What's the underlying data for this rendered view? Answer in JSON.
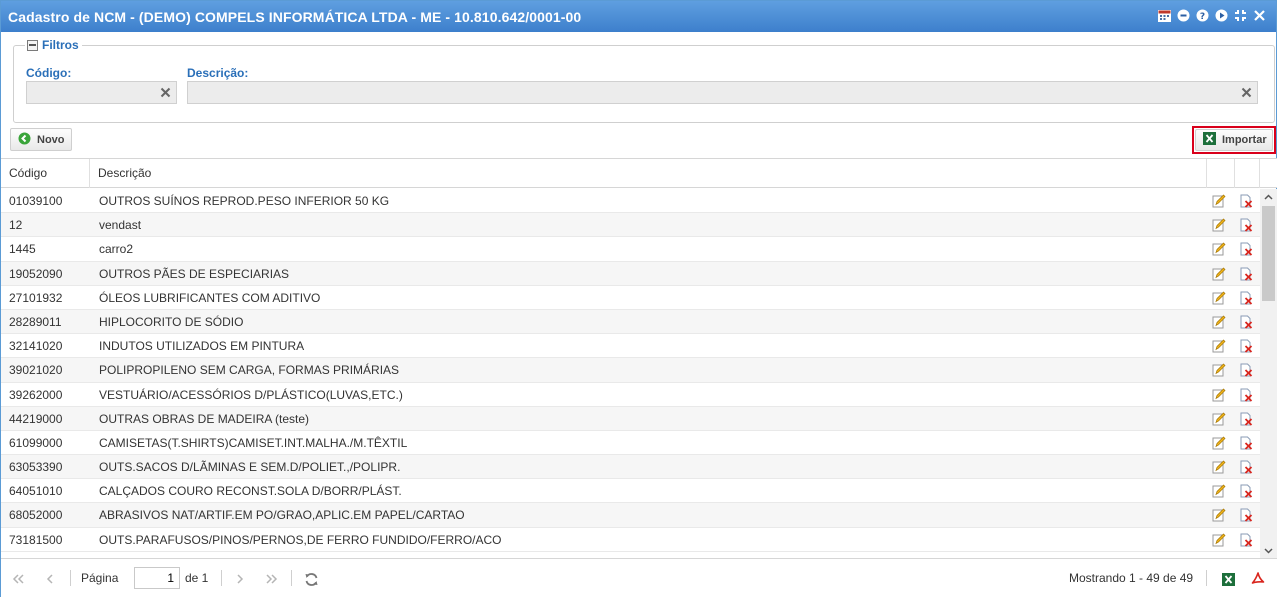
{
  "window": {
    "title": "Cadastro de NCM - (DEMO) COMPELS INFORMÁTICA LTDA - ME - 10.810.642/0001-00",
    "titlebar_icons": [
      "calendar-icon",
      "minimize-icon",
      "help-icon",
      "play-icon",
      "expand-icon",
      "close-icon"
    ]
  },
  "filters": {
    "legend": "Filtros",
    "codigo_label": "Código:",
    "codigo_value": "",
    "descricao_label": "Descrição:",
    "descricao_value": ""
  },
  "toolbar": {
    "novo_label": "Novo",
    "importar_label": "Importar"
  },
  "grid": {
    "columns": [
      "Código",
      "Descrição"
    ],
    "rows": [
      {
        "codigo": "01039100",
        "descricao": "OUTROS SUÍNOS REPROD.PESO INFERIOR 50 KG"
      },
      {
        "codigo": "12",
        "descricao": "vendast"
      },
      {
        "codigo": "1445",
        "descricao": "carro2"
      },
      {
        "codigo": "19052090",
        "descricao": "OUTROS PÃES DE ESPECIARIAS"
      },
      {
        "codigo": "27101932",
        "descricao": "ÓLEOS LUBRIFICANTES COM ADITIVO"
      },
      {
        "codigo": "28289011",
        "descricao": "HIPLOCORITO DE SÓDIO"
      },
      {
        "codigo": "32141020",
        "descricao": "INDUTOS UTILIZADOS EM PINTURA"
      },
      {
        "codigo": "39021020",
        "descricao": "POLIPROPILENO SEM CARGA, FORMAS PRIMÁRIAS"
      },
      {
        "codigo": "39262000",
        "descricao": "VESTUÁRIO/ACESSÓRIOS D/PLÁSTICO(LUVAS,ETC.)"
      },
      {
        "codigo": "44219000",
        "descricao": "OUTRAS OBRAS DE MADEIRA (teste)"
      },
      {
        "codigo": "61099000",
        "descricao": "CAMISETAS(T.SHIRTS)CAMISET.INT.MALHA./M.TÊXTIL"
      },
      {
        "codigo": "63053390",
        "descricao": "OUTS.SACOS D/LÃMINAS E SEM.D/POLIET.,/POLIPR."
      },
      {
        "codigo": "64051010",
        "descricao": "CALÇADOS COURO RECONST.SOLA D/BORR/PLÁST."
      },
      {
        "codigo": "68052000",
        "descricao": "ABRASIVOS NAT/ARTIF.EM PO/GRAO,APLIC.EM PAPEL/CARTAO"
      },
      {
        "codigo": "73181500",
        "descricao": "OUTS.PARAFUSOS/PINOS/PERNOS,DE FERRO FUNDIDO/FERRO/ACO"
      }
    ]
  },
  "pager": {
    "page_label": "Página",
    "page_value": "1",
    "of_label": "de 1",
    "summary": "Mostrando 1 - 49 de 49"
  },
  "colors": {
    "titlebar": "#4a8ad6",
    "accent_label": "#2a6fb8",
    "highlight_border": "#d9001b"
  }
}
